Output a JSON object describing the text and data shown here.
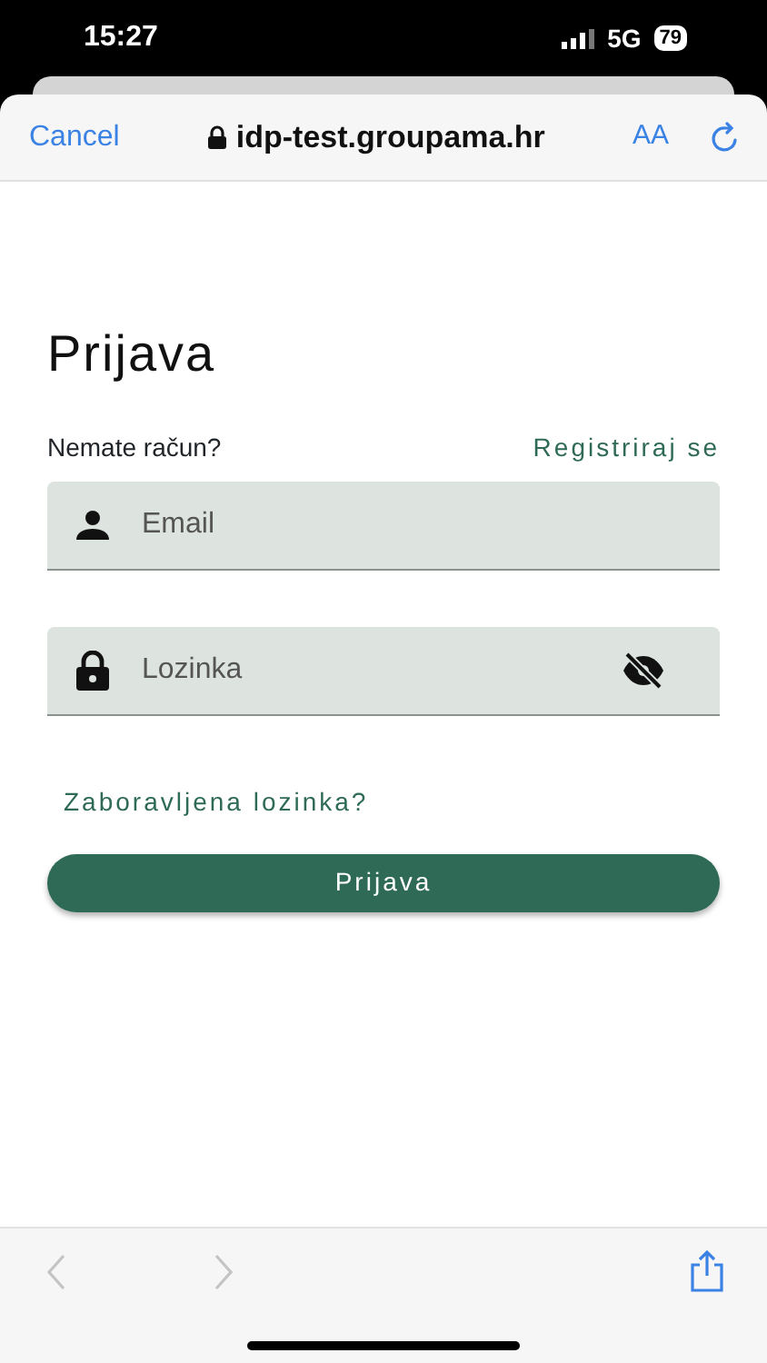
{
  "status_bar": {
    "time": "15:27",
    "network": "5G",
    "battery": "79"
  },
  "browser": {
    "cancel": "Cancel",
    "url": "idp-test.groupama.hr",
    "text_size": "AA"
  },
  "page": {
    "title": "Prijava",
    "no_account": "Nemate račun?",
    "register_link": "Registriraj se",
    "fields": [
      {
        "kind": "email",
        "placeholder": "Email"
      },
      {
        "kind": "password",
        "placeholder": "Lozinka"
      }
    ],
    "forgot_link": "Zaboravljena lozinka?",
    "submit": "Prijava"
  },
  "toolbar": {
    "back_disabled": true,
    "forward_disabled": true
  }
}
